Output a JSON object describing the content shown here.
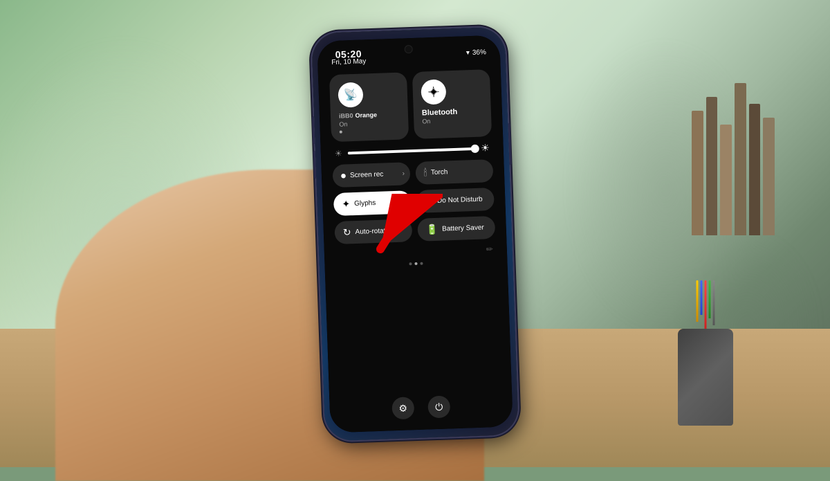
{
  "background": {
    "color_left": "#8ab88a",
    "color_right": "#607060"
  },
  "phone": {
    "status_bar": {
      "time": "05:20",
      "date": "Fri, 10 May",
      "wifi": "▾",
      "battery": "36%"
    },
    "tiles": {
      "large": [
        {
          "icon": "📶",
          "label": "iBB0",
          "sublabel": "Orange",
          "status": "On",
          "has_dot": true
        },
        {
          "icon": "✦",
          "label": "Bluetooth",
          "status": "On",
          "has_dot": false
        }
      ],
      "small_row1": [
        {
          "icon": "⏺",
          "label": "Screen rec",
          "active": false,
          "has_arrow": true
        },
        {
          "icon": "🔦",
          "label": "Torch",
          "active": false,
          "has_arrow": false
        }
      ],
      "small_row2": [
        {
          "icon": "✦",
          "label": "Glyphs",
          "active": true,
          "has_arrow": false
        },
        {
          "icon": "⊘",
          "label": "Do Not Disturb",
          "active": false,
          "has_arrow": false
        }
      ],
      "small_row3": [
        {
          "icon": "↻",
          "label": "Auto-rotate",
          "active": false,
          "has_arrow": false
        },
        {
          "icon": "🔋",
          "label": "Battery Saver",
          "active": false,
          "has_arrow": false
        }
      ]
    },
    "bottom": {
      "settings_icon": "⚙",
      "power_icon": "⏻"
    },
    "page_dots": [
      false,
      true,
      false
    ],
    "edit_icon": "✏"
  },
  "arrow": {
    "color": "#e00000",
    "pointing_to": "Glyphs tile"
  }
}
